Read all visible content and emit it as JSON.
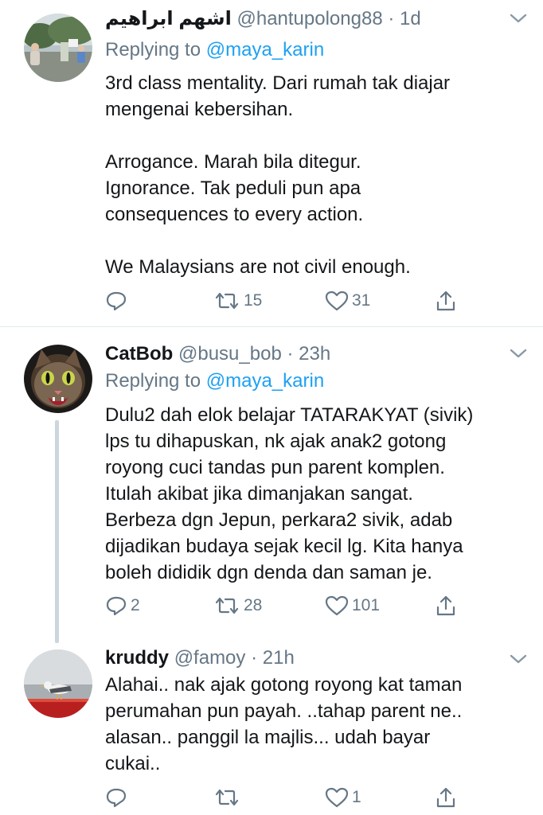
{
  "tweets": [
    {
      "display_name": "اشهم ابراهيم",
      "handle": "@hantupolong88",
      "dot": "·",
      "time": "1d",
      "replying_prefix": "Replying to",
      "replying_to": "@maya_karin",
      "lines": [
        "3rd class mentality. Dari rumah tak diajar",
        "mengenai kebersihan.",
        "",
        "Arrogance. Marah bila ditegur.",
        "Ignorance. Tak peduli pun apa",
        "consequences to every action.",
        "",
        "We Malaysians are not civil enough."
      ],
      "reply_count": "",
      "retweet_count": "15",
      "like_count": "31"
    },
    {
      "display_name": "CatBob",
      "handle": "@busu_bob",
      "dot": "·",
      "time": "23h",
      "replying_prefix": "Replying to",
      "replying_to": "@maya_karin",
      "lines": [
        "Dulu2 dah elok belajar TATARAKYAT (sivik)",
        "lps tu dihapuskan, nk ajak anak2 gotong",
        "royong cuci tandas pun parent komplen.",
        "Itulah akibat jika dimanjakan sangat.",
        "Berbeza dgn Jepun, perkara2 sivik, adab",
        "dijadikan budaya sejak kecil lg. Kita hanya",
        "boleh dididik dgn denda dan saman je."
      ],
      "reply_count": "2",
      "retweet_count": "28",
      "like_count": "101"
    },
    {
      "display_name": "kruddy",
      "handle": "@famoy",
      "dot": "·",
      "time": "21h",
      "lines": [
        "Alahai.. nak ajak gotong royong kat taman",
        "perumahan pun payah. ..tahap parent ne..",
        "alasan.. panggil la majlis... udah bayar",
        "cukai.."
      ],
      "reply_count": "",
      "retweet_count": "",
      "like_count": "1"
    }
  ],
  "colors": {
    "text": "#14171a",
    "muted": "#657786",
    "link": "#1da1f2",
    "thread_line": "#ccd6dd",
    "divider": "#e1e8ed"
  },
  "icons": [
    "reply-icon",
    "retweet-icon",
    "like-icon",
    "share-icon",
    "chevron-down-icon"
  ]
}
